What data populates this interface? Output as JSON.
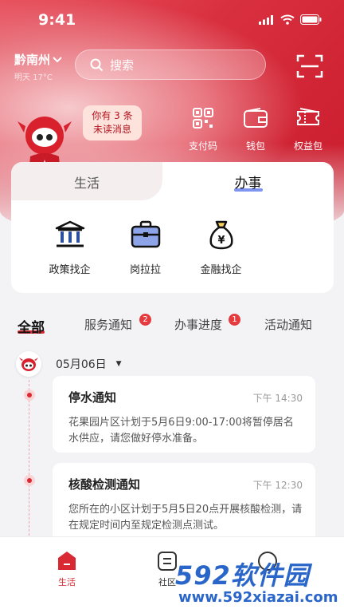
{
  "status": {
    "time": "9:41"
  },
  "header": {
    "city": "黔南州",
    "weather": "明天 17°C",
    "search_placeholder": "搜索"
  },
  "mascot": {
    "bubble_line1": "你有 3 条",
    "bubble_line2": "未读消息"
  },
  "quick_actions": [
    {
      "label": "支付码",
      "icon": "qr-code-icon"
    },
    {
      "label": "钱包",
      "icon": "wallet-icon"
    },
    {
      "label": "权益包",
      "icon": "ticket-icon"
    }
  ],
  "service_card": {
    "tabs": [
      {
        "label": "生活"
      },
      {
        "label": "办事"
      }
    ],
    "active_tab": "办事",
    "items": [
      {
        "label": "政策找企",
        "icon": "government-building-icon"
      },
      {
        "label": "岗拉拉",
        "icon": "briefcase-icon"
      },
      {
        "label": "金融找企",
        "icon": "money-bag-icon"
      }
    ]
  },
  "filters": [
    {
      "label": "全部",
      "active": true
    },
    {
      "label": "服务通知",
      "badge": "2"
    },
    {
      "label": "办事进度",
      "badge": "1"
    },
    {
      "label": "活动通知"
    }
  ],
  "feed": {
    "date": "05月06日",
    "notices": [
      {
        "title": "停水通知",
        "time": "下午 14:30",
        "body": "花果园片区计划于5月6日9:00-17:00将暂停居名水供应，请您做好停水准备。"
      },
      {
        "title": "核酸检测通知",
        "time": "下午 12:30",
        "body": "您所在的小区计划于5月5日20点开展核酸检测，请在规定时间内至规定检测点测试。"
      }
    ]
  },
  "tabbar": [
    {
      "label": "生活",
      "active": true
    },
    {
      "label": "社区"
    }
  ],
  "watermark": {
    "brand": "592软件园",
    "url": "www.592xiazai.com"
  },
  "colors": {
    "brand_red": "#d92a34",
    "accent_blue": "#7f94f0",
    "watermark_blue": "#2a66c9"
  }
}
